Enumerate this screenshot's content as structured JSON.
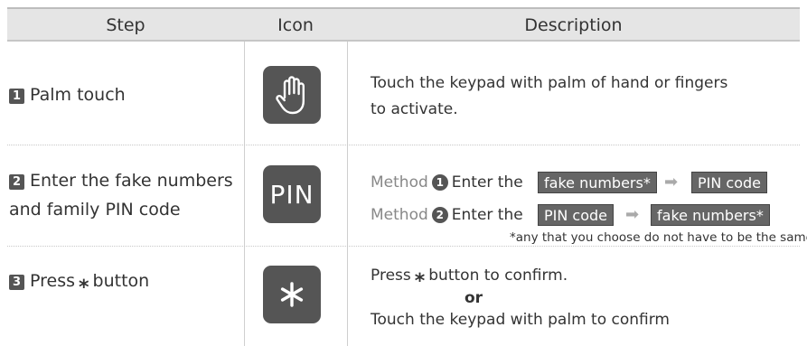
{
  "header": {
    "step": "Step",
    "icon": "Icon",
    "description": "Description"
  },
  "rows": [
    {
      "num": "1",
      "step": "Palm touch",
      "icon": "palm-hand-icon",
      "desc_line1": "Touch the keypad with palm of hand or fingers",
      "desc_line2": "to activate."
    },
    {
      "num": "2",
      "step_line1": "Enter the fake numbers",
      "step_line2": "and family PIN code",
      "icon": "pin-icon",
      "icon_text": "PIN",
      "method_word": "Method",
      "m1_num": "1",
      "m2_num": "2",
      "enter_the": "Enter the",
      "m1_first": "fake numbers*",
      "m1_second": "PIN code",
      "m2_first": "PIN code",
      "m2_second": "fake numbers*",
      "arrow": "➡",
      "note": "*any that you choose do not have to be the same."
    },
    {
      "num": "3",
      "step_prefix": "Press",
      "star": "⁎",
      "step_suffix": "button",
      "icon": "asterisk-button-icon",
      "desc_prefix": "Press",
      "desc_suffix": "button to confirm.",
      "or": "or",
      "desc_line3": "Touch the keypad with palm to confirm"
    }
  ],
  "colors": {
    "header_bg": "#e5e5e5",
    "icon_bg": "#555555",
    "pill_bg": "#666666",
    "arrow": "#aaaaaa"
  }
}
